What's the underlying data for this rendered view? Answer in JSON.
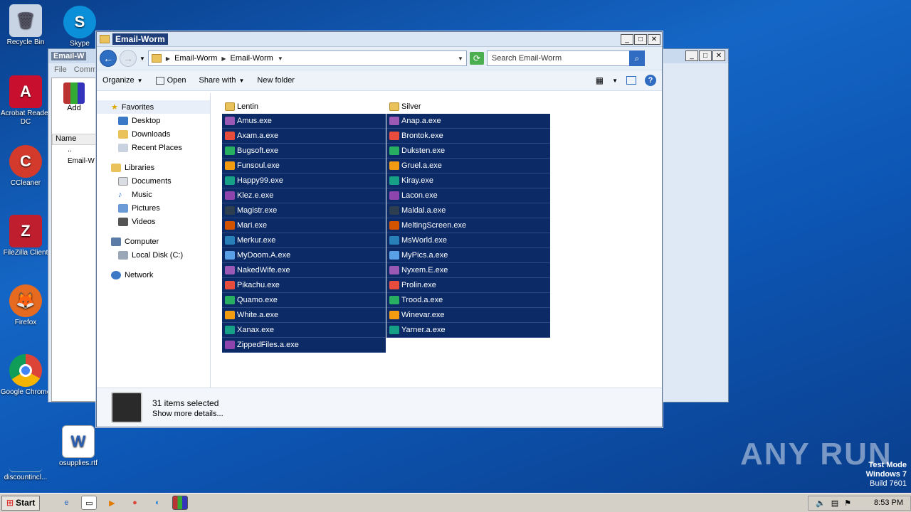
{
  "desktop": {
    "icons": [
      {
        "label": "Recycle Bin",
        "icon": "recycle-bin-icon",
        "color": "#c8d4e4"
      },
      {
        "label": "Acrobat Reader DC",
        "icon": "acrobat-icon",
        "color": "#c8102e"
      },
      {
        "label": "CCleaner",
        "icon": "ccleaner-icon",
        "color": "#d33a2c"
      },
      {
        "label": "FileZilla Client",
        "icon": "filezilla-icon",
        "color": "#bf1e2e"
      },
      {
        "label": "Firefox",
        "icon": "firefox-icon",
        "color": "#e66a1f"
      },
      {
        "label": "Google Chrome",
        "icon": "chrome-icon",
        "color": "#2a8f3e"
      },
      {
        "label": "Skype",
        "icon": "skype-icon",
        "color": "#0a8fd8"
      },
      {
        "label": "discountincl...",
        "icon": "file-icon",
        "color": "#1a5aab"
      },
      {
        "label": "osupplies.rtf",
        "icon": "word-icon",
        "color": "#2b5fb3"
      }
    ]
  },
  "bg_window": {
    "title": "Email-W",
    "menu": [
      "File",
      "Comm"
    ],
    "add_label": "Add",
    "name_header": "Name",
    "rows": [
      "..",
      "Email-W"
    ]
  },
  "window": {
    "title": "Email-Worm",
    "breadcrumb": [
      "Email-Worm",
      "Email-Worm"
    ],
    "search_placeholder": "Search Email-Worm",
    "toolbar": {
      "organize": "Organize",
      "open": "Open",
      "share_with": "Share with",
      "new_folder": "New folder"
    },
    "nav": {
      "favorites": "Favorites",
      "desktop": "Desktop",
      "downloads": "Downloads",
      "recent_places": "Recent Places",
      "libraries": "Libraries",
      "documents": "Documents",
      "music": "Music",
      "pictures": "Pictures",
      "videos": "Videos",
      "computer": "Computer",
      "local_disk": "Local Disk (C:)",
      "network": "Network"
    },
    "files_left": [
      {
        "name": "Lentin",
        "type": "folder",
        "sel": false
      },
      {
        "name": "Amus.exe",
        "sel": true
      },
      {
        "name": "Axam.a.exe",
        "sel": true
      },
      {
        "name": "Bugsoft.exe",
        "sel": true
      },
      {
        "name": "Funsoul.exe",
        "sel": true
      },
      {
        "name": "Happy99.exe",
        "sel": true
      },
      {
        "name": "Klez.e.exe",
        "sel": true
      },
      {
        "name": "Magistr.exe",
        "sel": true
      },
      {
        "name": "Mari.exe",
        "sel": true
      },
      {
        "name": "Merkur.exe",
        "sel": true
      },
      {
        "name": "MyDoom.A.exe",
        "sel": true
      },
      {
        "name": "NakedWife.exe",
        "sel": true
      },
      {
        "name": "Pikachu.exe",
        "sel": true
      },
      {
        "name": "Quamo.exe",
        "sel": true
      },
      {
        "name": "White.a.exe",
        "sel": true
      },
      {
        "name": "Xanax.exe",
        "sel": true
      },
      {
        "name": "ZippedFiles.a.exe",
        "sel": true
      }
    ],
    "files_right": [
      {
        "name": "Silver",
        "type": "folder",
        "sel": false
      },
      {
        "name": "Anap.a.exe",
        "sel": true
      },
      {
        "name": "Brontok.exe",
        "sel": true
      },
      {
        "name": "Duksten.exe",
        "sel": true
      },
      {
        "name": "Gruel.a.exe",
        "sel": true
      },
      {
        "name": "Kiray.exe",
        "sel": true
      },
      {
        "name": "Lacon.exe",
        "sel": true
      },
      {
        "name": "Maldal.a.exe",
        "sel": true
      },
      {
        "name": "MeltingScreen.exe",
        "sel": true
      },
      {
        "name": "MsWorld.exe",
        "sel": true
      },
      {
        "name": "MyPics.a.exe",
        "sel": true
      },
      {
        "name": "Nyxem.E.exe",
        "sel": true
      },
      {
        "name": "Prolin.exe",
        "sel": true
      },
      {
        "name": "Trood.a.exe",
        "sel": true
      },
      {
        "name": "Winevar.exe",
        "sel": true
      },
      {
        "name": "Yarner.a.exe",
        "sel": true
      }
    ],
    "details": {
      "count": "31 items selected",
      "more": "Show more details..."
    }
  },
  "watermark": "ANY RUN",
  "testmode": {
    "line1": "Test Mode",
    "line2": "Windows 7",
    "line3": "Build 7601"
  },
  "taskbar": {
    "start": "Start",
    "clock": "8:53 PM"
  }
}
